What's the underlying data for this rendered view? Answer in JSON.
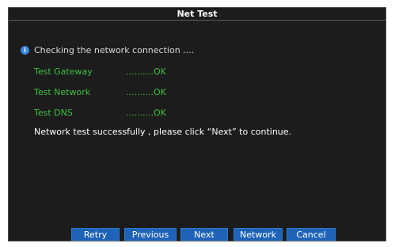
{
  "dialog": {
    "title": "Net Test"
  },
  "status": {
    "icon": "info-icon",
    "icon_color": "#3a86d6",
    "text": "Checking the network connection ...."
  },
  "checks": [
    {
      "name": "Test Gateway",
      "result": "..........OK"
    },
    {
      "name": "Test Network",
      "result": "..........OK"
    },
    {
      "name": "Test DNS",
      "result": "..........OK"
    }
  ],
  "message": "Network test successfully , please click “Next” to continue.",
  "buttons": {
    "retry": "Retry",
    "previous": "Previous",
    "next": "Next",
    "network": "Network",
    "cancel": "Cancel"
  },
  "colors": {
    "background": "#1c1c1c",
    "check_text": "#3fbf3f",
    "button": "#1e63b8"
  }
}
